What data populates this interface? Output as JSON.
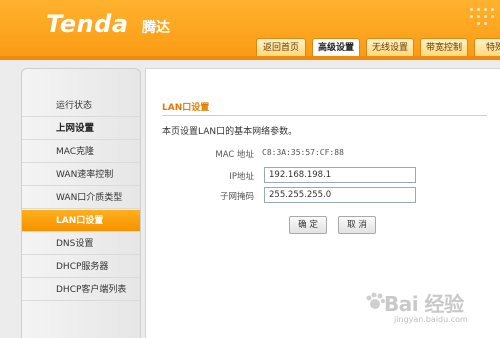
{
  "header": {
    "logo_text": "Tenda",
    "logo_cn": "腾达",
    "tabs": [
      {
        "label": "返回首页",
        "active": false
      },
      {
        "label": "高级设置",
        "active": true
      },
      {
        "label": "无线设置",
        "active": false
      },
      {
        "label": "带宽控制",
        "active": false
      },
      {
        "label": "特殊",
        "active": false
      }
    ]
  },
  "sidebar": {
    "items": [
      {
        "label": "运行状态"
      },
      {
        "label": "上网设置"
      },
      {
        "label": "MAC克隆"
      },
      {
        "label": "WAN速率控制"
      },
      {
        "label": "WAN口介质类型"
      },
      {
        "label": "LAN口设置"
      },
      {
        "label": "DNS设置"
      },
      {
        "label": "DHCP服务器"
      },
      {
        "label": "DHCP客户端列表"
      }
    ]
  },
  "main": {
    "title": "LAN口设置",
    "description": "本页设置LAN口的基本网络参数。",
    "mac_label": "MAC 地址",
    "mac_value": "C8:3A:35:57:CF:88",
    "ip_label": "IP地址",
    "ip_value": "192.168.198.1",
    "mask_label": "子网掩码",
    "mask_value": "255.255.255.0",
    "ok_label": "确 定",
    "cancel_label": "取 消"
  },
  "watermark": {
    "text": "Bai 经验",
    "sub": "jingyan.baidu.com"
  },
  "colors": {
    "header_orange": "#fb9a14",
    "accent_orange": "#f79100",
    "title_orange": "#e07b00"
  }
}
